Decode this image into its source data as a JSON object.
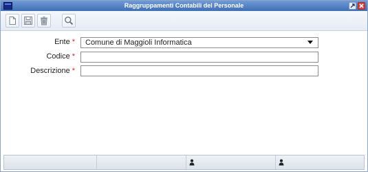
{
  "window": {
    "title": "Raggruppamenti Contabili del Personale"
  },
  "toolbar": {
    "buttons": [
      {
        "name": "new",
        "icon": "new-document-icon"
      },
      {
        "name": "save",
        "icon": "save-icon"
      },
      {
        "name": "delete",
        "icon": "trash-icon"
      },
      {
        "name": "search",
        "icon": "search-icon"
      }
    ]
  },
  "form": {
    "ente_label": "Ente",
    "ente_value": "Comune di Maggioli Informatica",
    "codice_label": "Codice",
    "codice_value": "",
    "descrizione_label": "Descrizione",
    "descrizione_value": "",
    "required_mark": "*"
  },
  "statusbar": {
    "icons": [
      "user-icon",
      "user-icon"
    ]
  },
  "colors": {
    "titlebar": "#3f6fb5",
    "required": "#e02020",
    "close": "#d9423a"
  }
}
